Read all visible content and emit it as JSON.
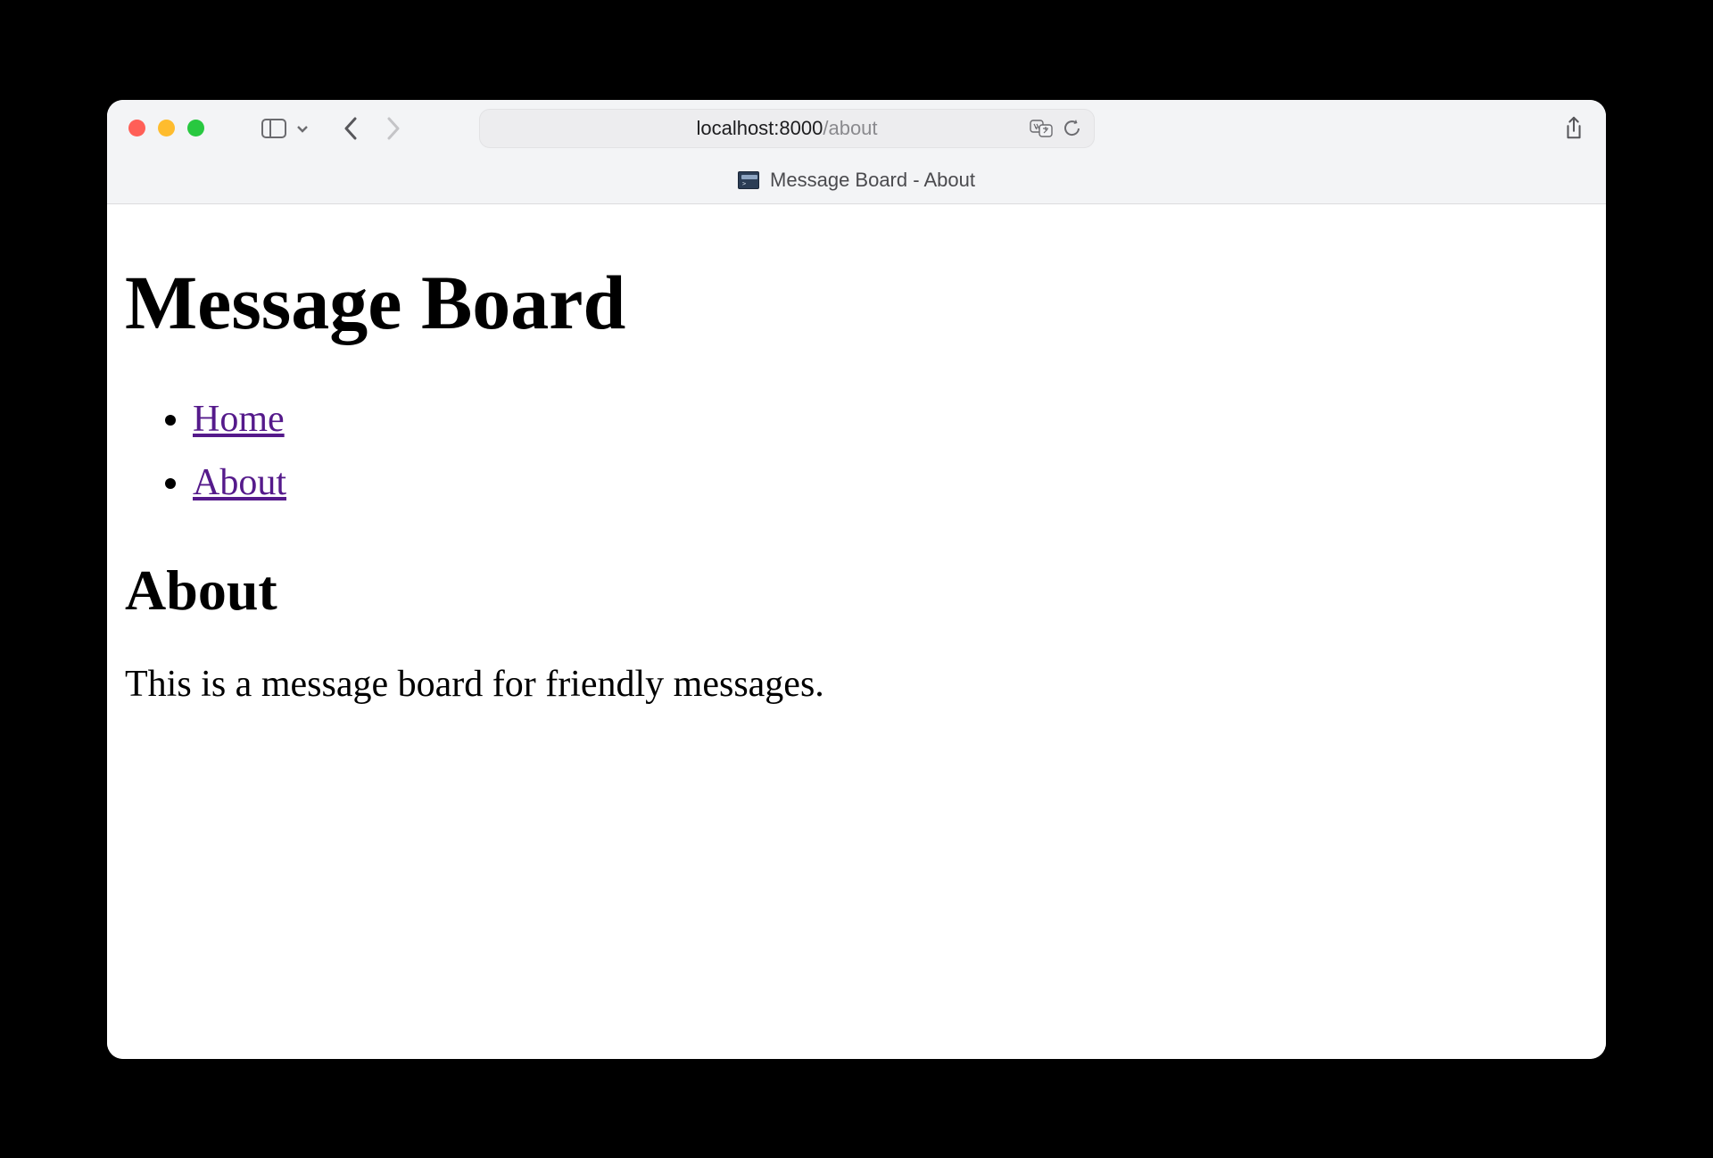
{
  "browser": {
    "url_host": "localhost:8000",
    "url_path": "/about",
    "tab_title": "Message Board - About"
  },
  "page": {
    "site_title": "Message Board",
    "nav": [
      {
        "label": "Home"
      },
      {
        "label": "About"
      }
    ],
    "heading": "About",
    "body_text": "This is a message board for friendly messages."
  }
}
